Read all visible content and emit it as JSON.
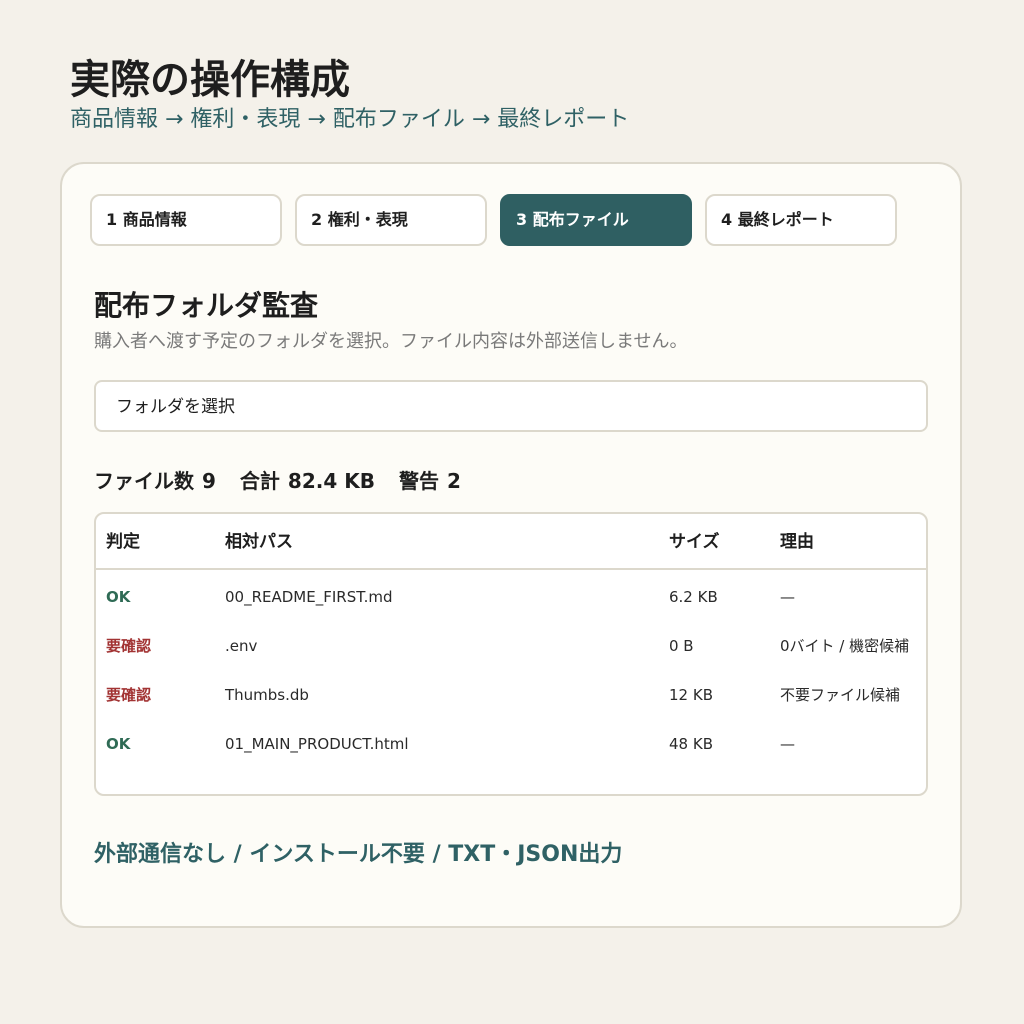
{
  "colors": {
    "background": "#f4f1ea",
    "card": "#fdfcf7",
    "accent": "#2f5f62",
    "ok": "#2f6b55",
    "warn": "#a23333"
  },
  "header": {
    "title": "実際の操作構成",
    "subtitle": "商品情報 → 権利・表現 → 配布ファイル → 最終レポート"
  },
  "tabs": [
    {
      "label": "1 商品情報",
      "active": false
    },
    {
      "label": "2 権利・表現",
      "active": false
    },
    {
      "label": "3 配布ファイル",
      "active": true
    },
    {
      "label": "4 最終レポート",
      "active": false
    }
  ],
  "section": {
    "title": "配布フォルダ監査",
    "description": "購入者へ渡す予定のフォルダを選択。ファイル内容は外部送信しません。"
  },
  "folder_button": {
    "label": "フォルダを選択"
  },
  "stats": {
    "file_count_label": "ファイル数",
    "file_count": "9",
    "total_label": "合計",
    "total": "82.4 KB",
    "warning_label": "警告",
    "warning": "2"
  },
  "table": {
    "headers": [
      "判定",
      "相対パス",
      "サイズ",
      "理由"
    ],
    "rows": [
      {
        "verdict": "OK",
        "status": "ok",
        "path": "00_README_FIRST.md",
        "size": "6.2 KB",
        "reason": "—"
      },
      {
        "verdict": "要確認",
        "status": "warn",
        "path": ".env",
        "size": "0 B",
        "reason": "0バイト / 機密候補"
      },
      {
        "verdict": "要確認",
        "status": "warn",
        "path": "Thumbs.db",
        "size": "12 KB",
        "reason": "不要ファイル候補"
      },
      {
        "verdict": "OK",
        "status": "ok",
        "path": "01_MAIN_PRODUCT.html",
        "size": "48 KB",
        "reason": "—"
      }
    ]
  },
  "footer": {
    "note": "外部通信なし / インストール不要 / TXT・JSON出力"
  }
}
